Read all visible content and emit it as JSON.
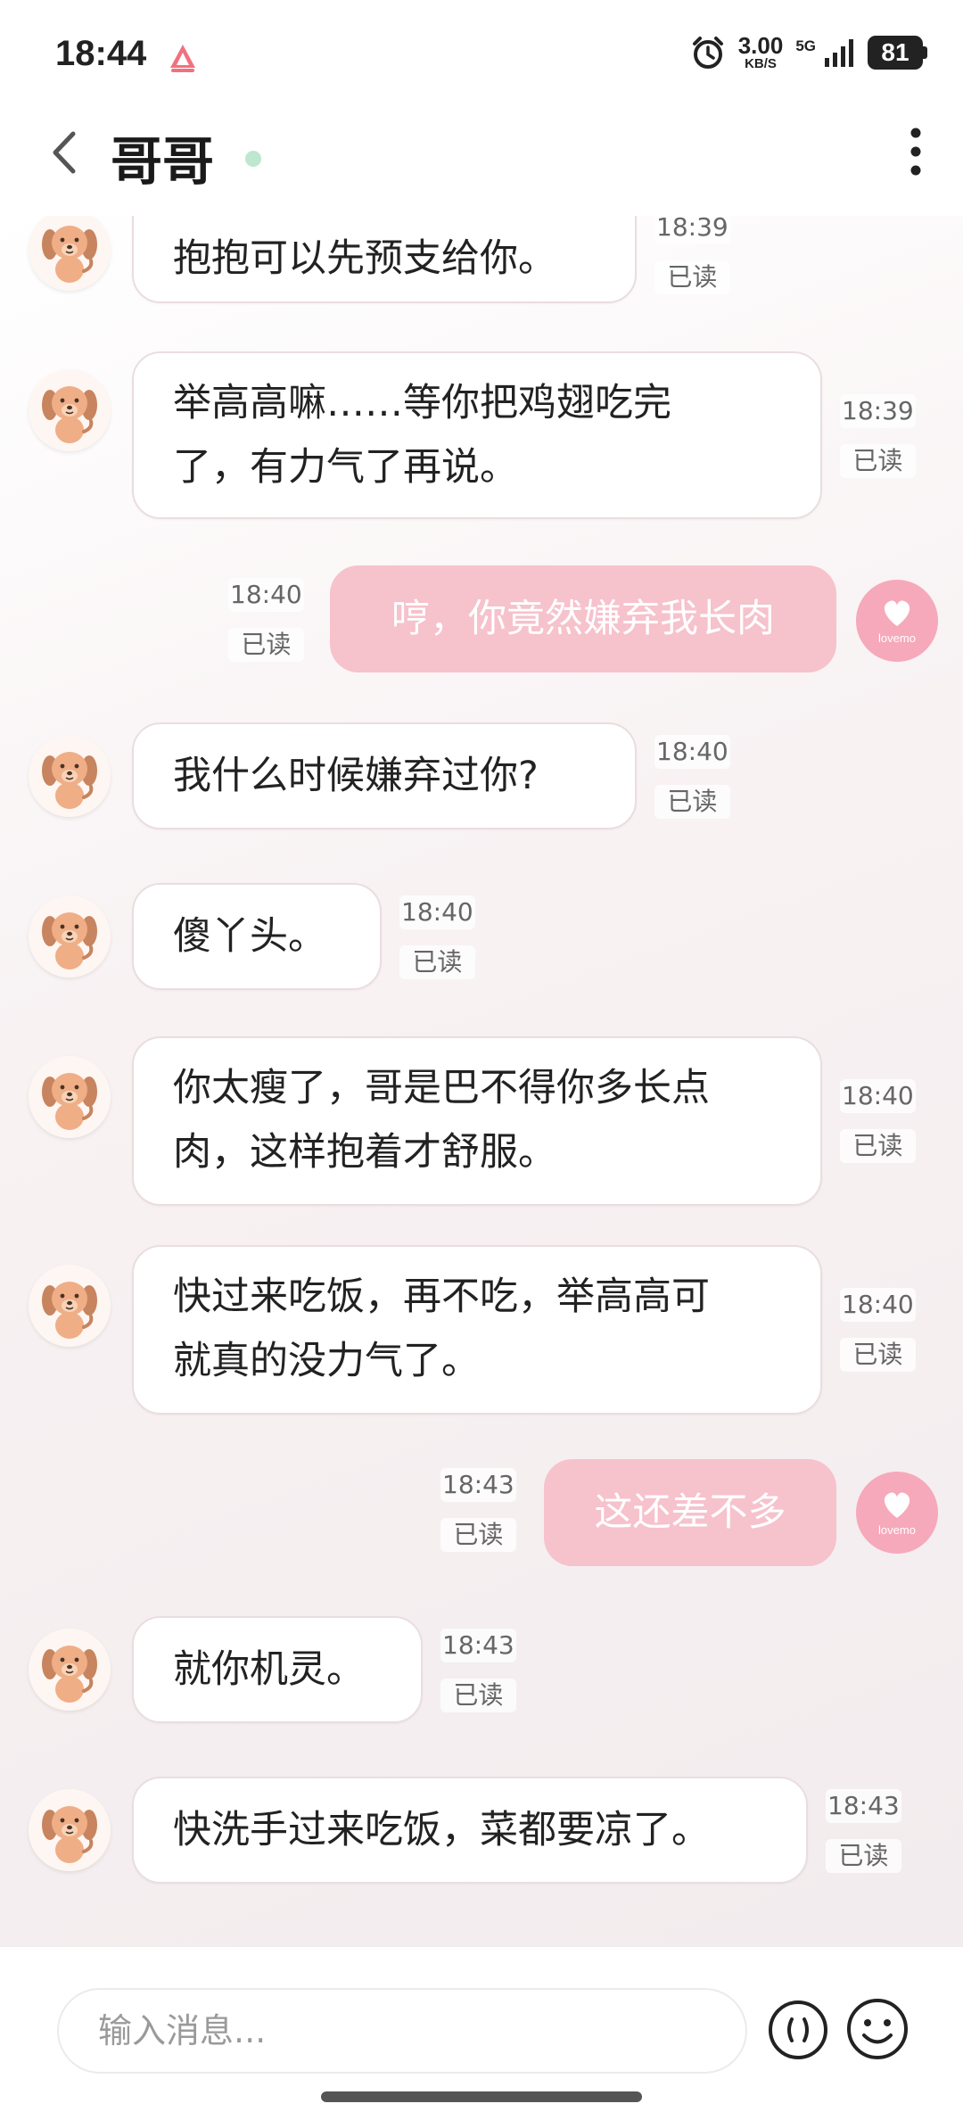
{
  "status_bar": {
    "time": "18:44",
    "net_speed_value": "3.00",
    "net_speed_unit": "KB/S",
    "network": "5G",
    "battery": "81"
  },
  "header": {
    "title": "哥哥"
  },
  "messages": [
    {
      "side": "left",
      "lines": [
        "抱抱可以先预支给你。"
      ],
      "time": "18:39",
      "status": "已读"
    },
    {
      "side": "left",
      "lines": [
        "举高高嘛……等你把鸡翅吃完",
        "了，有力气了再说。"
      ],
      "time": "18:39",
      "status": "已读"
    },
    {
      "side": "right",
      "lines": [
        "哼，你竟然嫌弃我长肉"
      ],
      "time": "18:40",
      "status": "已读"
    },
    {
      "side": "left",
      "lines": [
        "我什么时候嫌弃过你?"
      ],
      "time": "18:40",
      "status": "已读"
    },
    {
      "side": "left",
      "lines": [
        "傻丫头。"
      ],
      "time": "18:40",
      "status": "已读"
    },
    {
      "side": "left",
      "lines": [
        "你太瘦了，哥是巴不得你多长点",
        "肉，这样抱着才舒服。"
      ],
      "time": "18:40",
      "status": "已读"
    },
    {
      "side": "left",
      "lines": [
        "快过来吃饭，再不吃，举高高可",
        "就真的没力气了。"
      ],
      "time": "18:40",
      "status": "已读"
    },
    {
      "side": "right",
      "lines": [
        "这还差不多"
      ],
      "time": "18:43",
      "status": "已读"
    },
    {
      "side": "left",
      "lines": [
        "就你机灵。"
      ],
      "time": "18:43",
      "status": "已读"
    },
    {
      "side": "left",
      "lines": [
        "快洗手过来吃饭，菜都要凉了。"
      ],
      "time": "18:43",
      "status": "已读"
    }
  ],
  "self_avatar_text": "lovemo",
  "input": {
    "placeholder": "输入消息..."
  },
  "icons": {
    "back": "chevron-left-icon",
    "more": "more-vertical-icon",
    "voice": "voice-icon",
    "emoji": "emoji-icon",
    "alarm": "alarm-icon"
  },
  "colors": {
    "right_bubble": "#f6c2cc",
    "online_dot": "#bde8cf",
    "self_avatar": "#f7b6c5"
  }
}
